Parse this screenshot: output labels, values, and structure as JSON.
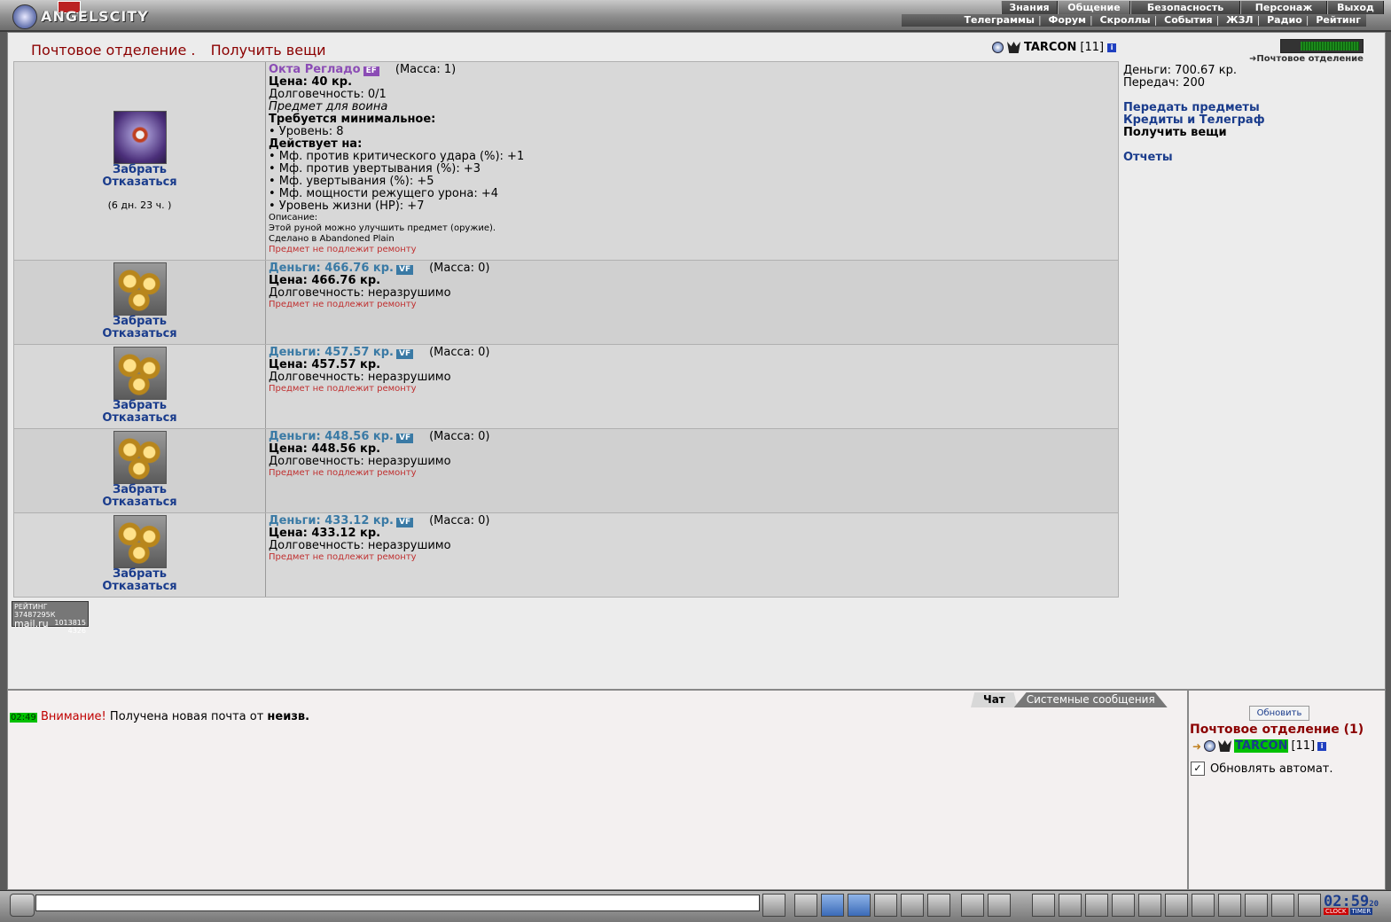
{
  "topbar": {
    "logo_text": "ANGELSCITY",
    "nav_main": [
      "Знания",
      "Общение",
      "Безопасность",
      "Персонаж",
      "Выход"
    ],
    "nav_active": "Общение",
    "nav_sub": [
      "Телеграммы",
      "Форум",
      "Скроллы",
      "События",
      "ЖЗЛ",
      "Радио",
      "Рейтинг"
    ]
  },
  "page": {
    "title_part1": "Почтовое отделение .",
    "title_part2": "Получить вещи"
  },
  "player": {
    "name": "TARCON",
    "level": "[11]"
  },
  "sidebar": {
    "post_link": "Почтовое отделение",
    "money": "Деньги: 700.67 кр.",
    "transfers": "Передач: 200",
    "links": [
      "Передать предметы",
      "Кредиты и Телеграф"
    ],
    "current": "Получить вещи",
    "reports": "Отчеты"
  },
  "actions": {
    "take": "Забрать",
    "refuse": "Отказаться"
  },
  "items": [
    {
      "name": "Окта Регладо",
      "badge": "EF",
      "mass": "(Масса: 1)",
      "price": "Цена: 40 кр.",
      "durability": "Долговечность: 0/1",
      "note": "Предмет для воина",
      "req_title": "Требуется минимальное:",
      "req": [
        "• Уровень: 8"
      ],
      "effects_title": "Действует на:",
      "effects": [
        "• Мф. против критического удара (%): +1",
        "• Мф. против увертывания (%): +3",
        "• Мф. увертывания (%): +5",
        "• Мф. мощности режущего урона: +4",
        "• Уровень жизни (HP): +7"
      ],
      "desc_title": "Описание:",
      "desc": "Этой руной можно улучшить предмет (оружие).",
      "made": "Сделано в Abandoned Plain",
      "repair": "Предмет не подлежит ремонту",
      "timer": "(6 дн. 23 ч. )"
    },
    {
      "name": "Деньги: 466.76 кр.",
      "badge": "VF",
      "mass": "(Масса: 0)",
      "price": "Цена: 466.76 кр.",
      "durability": "Долговечность: неразрушимо",
      "repair": "Предмет не подлежит ремонту"
    },
    {
      "name": "Деньги: 457.57 кр.",
      "badge": "VF",
      "mass": "(Масса: 0)",
      "price": "Цена: 457.57 кр.",
      "durability": "Долговечность: неразрушимо",
      "repair": "Предмет не подлежит ремонту"
    },
    {
      "name": "Деньги: 448.56 кр.",
      "badge": "VF",
      "mass": "(Масса: 0)",
      "price": "Цена: 448.56 кр.",
      "durability": "Долговечность: неразрушимо",
      "repair": "Предмет не подлежит ремонту"
    },
    {
      "name": "Деньги: 433.12 кр.",
      "badge": "VF",
      "mass": "(Масса: 0)",
      "price": "Цена: 433.12 кр.",
      "durability": "Долговечность: неразрушимо",
      "repair": "Предмет не подлежит ремонту"
    }
  ],
  "rating_counter": {
    "line1": "РЕЙТИНГ 37487295К",
    "line2": "mail.ru",
    "line3": "1013815",
    "line4": "4326"
  },
  "chat": {
    "tabs": [
      "Чат",
      "Системные сообщения"
    ],
    "message": {
      "time": "02:49",
      "warn": "Внимание!",
      "text": " Получена новая почта от ",
      "from": "неизв."
    }
  },
  "room": {
    "refresh": "Обновить",
    "title": "Почтовое отделение (1)",
    "user": "TARCON",
    "level": "[11]",
    "auto_update": "Обновлять автомат.",
    "auto_checked": "✓"
  },
  "clock": {
    "time": "02:59",
    "seconds": "20",
    "label_clock": "CLOCK",
    "label_timer": "TIMER"
  }
}
